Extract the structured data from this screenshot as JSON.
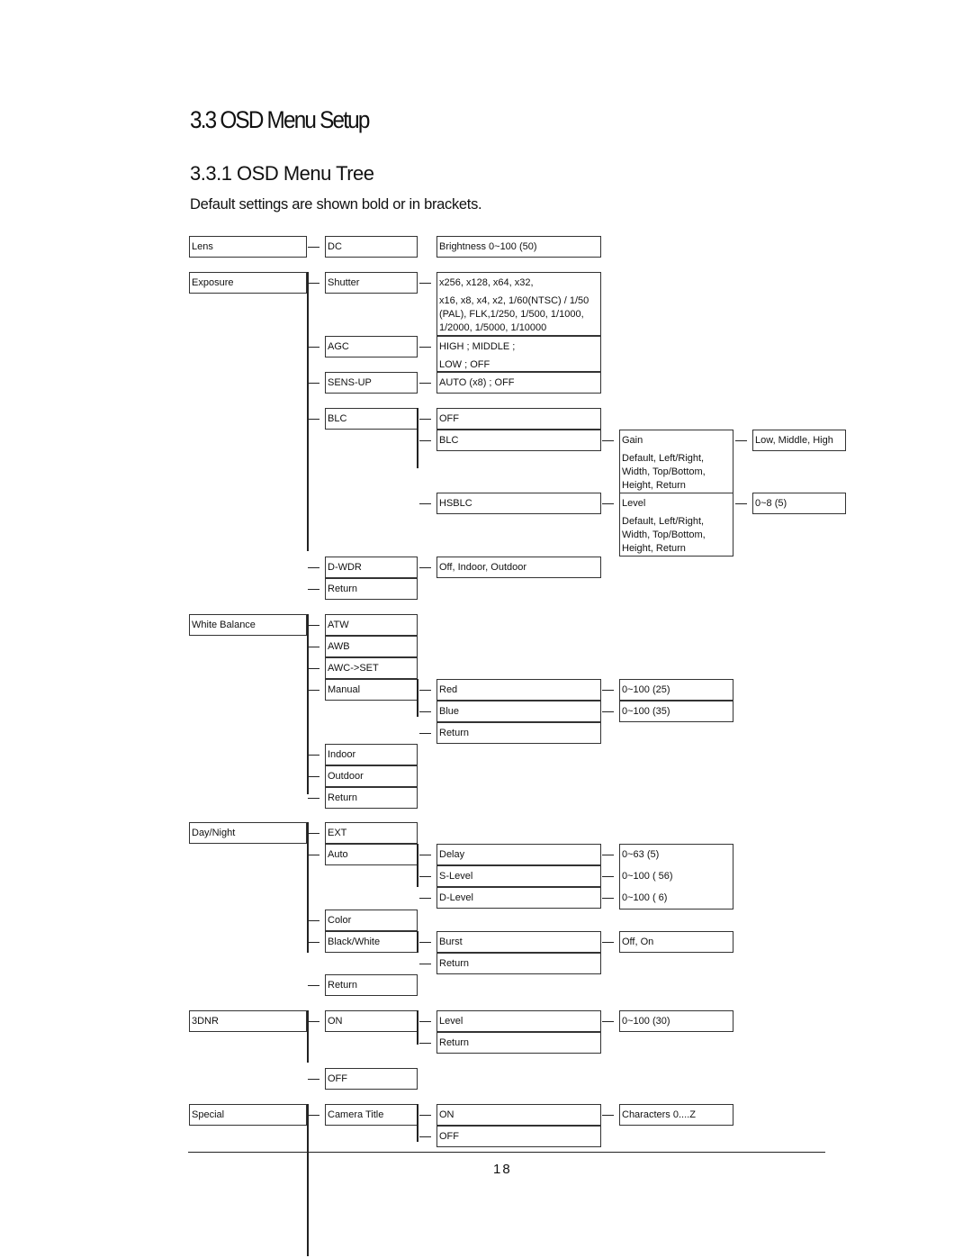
{
  "section_title": "3.3  OSD Menu Setup",
  "subsection_title": "3.3.1 OSD Menu Tree",
  "note": "Default settings are shown bold or in brackets.",
  "page_number": "18",
  "tree": {
    "col1": [
      "Lens",
      "Exposure",
      "White Balance",
      "Day/Night",
      "3DNR",
      "Special"
    ],
    "col2": [
      "DC",
      "Shutter",
      "AGC",
      "SENS-UP",
      "BLC",
      "D-WDR",
      "Return",
      "ATW",
      "AWB",
      "AWC->SET",
      "Manual",
      "Indoor",
      "Outdoor",
      "Return",
      "EXT",
      "Auto",
      "Color",
      "Black/White",
      "Return",
      "ON",
      "OFF",
      "Camera Title"
    ],
    "col3": [
      [
        "Brightness 0~100 (50)"
      ],
      [
        "x256, x128, x64, x32,",
        " x16, x8, x4, x2, 1/60(NTSC) / 1/50",
        "(PAL), FLK,1/250, 1/500,  1/1000,",
        "1/2000, 1/5000, 1/10000"
      ],
      [
        "HIGH ; MIDDLE ;",
        "LOW ; OFF"
      ],
      [
        "AUTO (x8) ; OFF"
      ],
      [
        "OFF"
      ],
      [
        "BLC"
      ],
      [
        "HSBLC"
      ],
      [
        "Off, Indoor, Outdoor"
      ],
      [
        "Red"
      ],
      [
        "Blue"
      ],
      [
        "Return"
      ],
      [
        "Delay"
      ],
      [
        "S-Level"
      ],
      [
        "D-Level"
      ],
      [
        "Burst"
      ],
      [
        "Return"
      ],
      [
        "Level"
      ],
      [
        "Return"
      ],
      [
        "ON"
      ],
      [
        "OFF"
      ]
    ],
    "col4": [
      [
        "Gain",
        "Default, Left/Right,",
        "Width, Top/Bottom,",
        "Height, Return"
      ],
      [
        "Level",
        "Default, Left/Right,",
        "Width, Top/Bottom,",
        "Height, Return"
      ],
      [
        "0~100 (25)"
      ],
      [
        "0~100 (35)"
      ],
      [
        "0~63 (5)",
        "0~100 ( 56)",
        "0~100 ( 6)"
      ],
      [
        "Off, On"
      ],
      [
        "0~100 (30)"
      ],
      [
        "Characters 0....Z"
      ]
    ],
    "col5": [
      [
        "Low, Middle, High"
      ],
      [
        "0~8 (5)"
      ]
    ]
  }
}
